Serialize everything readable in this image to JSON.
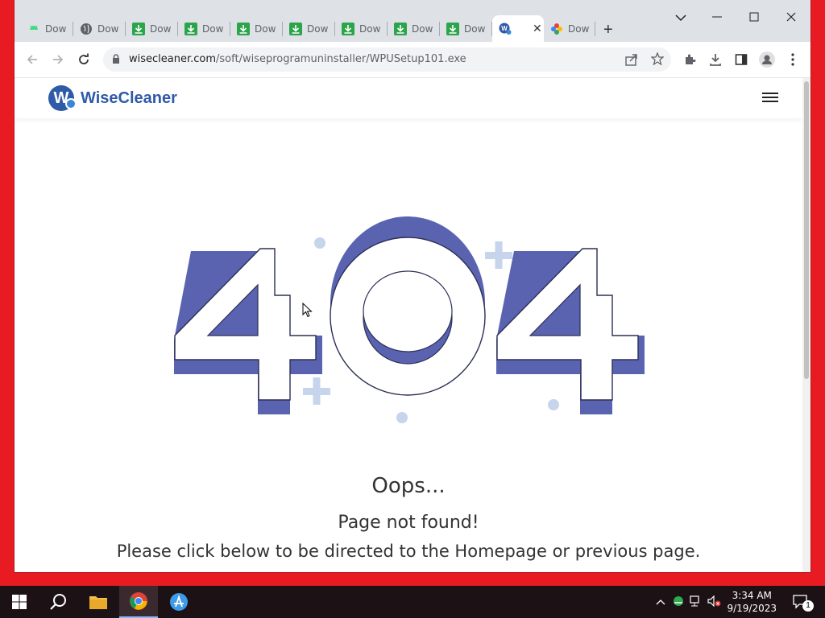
{
  "browser": {
    "tabs": [
      {
        "label": "Dow",
        "icon": "android-icon"
      },
      {
        "label": "Dow",
        "icon": "globe-icon"
      },
      {
        "label": "Dow",
        "icon": "download-icon"
      },
      {
        "label": "Dow",
        "icon": "download-icon"
      },
      {
        "label": "Dow",
        "icon": "download-icon"
      },
      {
        "label": "Dow",
        "icon": "download-icon"
      },
      {
        "label": "Dow",
        "icon": "download-icon"
      },
      {
        "label": "Dow",
        "icon": "download-icon"
      },
      {
        "label": "Dow",
        "icon": "download-icon"
      },
      {
        "label": "",
        "icon": "wisecleaner-icon",
        "active": true
      },
      {
        "label": "Dow",
        "icon": "colorful-flower-icon"
      }
    ],
    "url_domain": "wisecleaner.com",
    "url_path": "/soft/wiseprogramuninstaller/WPUSetup101.exe"
  },
  "site": {
    "brand": "WiseCleaner",
    "logo_letter": "W",
    "error_code": "404",
    "oops": "Oops...",
    "not_found": "Page not found!",
    "instruction": "Please click below to be directed to the Homepage or previous page.",
    "accent_color": "#5a63b0"
  },
  "taskbar": {
    "time": "3:34 AM",
    "date": "9/19/2023",
    "notification_count": "1"
  }
}
